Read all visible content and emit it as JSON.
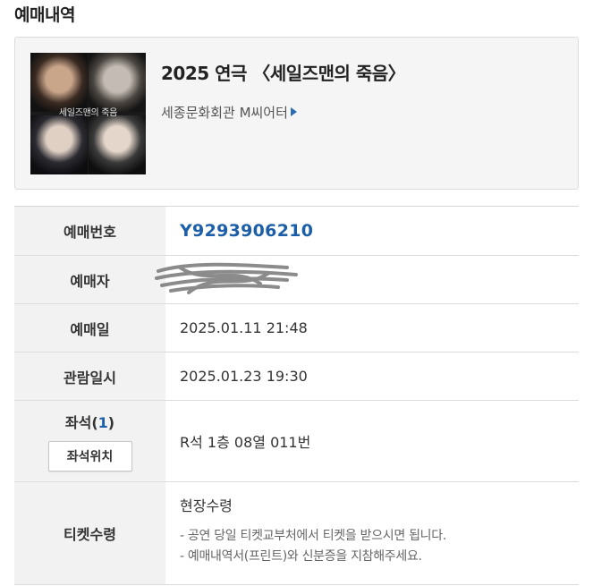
{
  "section_title": "예매내역",
  "show": {
    "title": "2025 연극 〈세일즈맨의 죽음〉",
    "venue": "세종문화회관 M씨어터",
    "poster_text": "세일즈맨의 죽음"
  },
  "details": {
    "reservation_number": {
      "label": "예매번호",
      "value": "Y9293906210"
    },
    "booker": {
      "label": "예매자",
      "value": ""
    },
    "booking_date": {
      "label": "예매일",
      "value": "2025.01.11 21:48"
    },
    "viewing_datetime": {
      "label": "관람일시",
      "value": "2025.01.23 19:30"
    },
    "seat": {
      "label": "좌석",
      "count_open": "(",
      "count": "1",
      "count_close": ")",
      "value": "R석 1층 08열 011번",
      "location_button": "좌석위치"
    },
    "ticket_pickup": {
      "label": "티켓수령",
      "method": "현장수령",
      "notes": [
        "- 공연 당일 티켓교부처에서 티켓을 받으시면 됩니다.",
        "- 예매내역서(프린트)와 신분증을 지참해주세요."
      ]
    }
  },
  "colors": {
    "accent": "#1c5ea8",
    "label_bg": "#f2f2f2",
    "card_bg": "#f5f5f5"
  }
}
